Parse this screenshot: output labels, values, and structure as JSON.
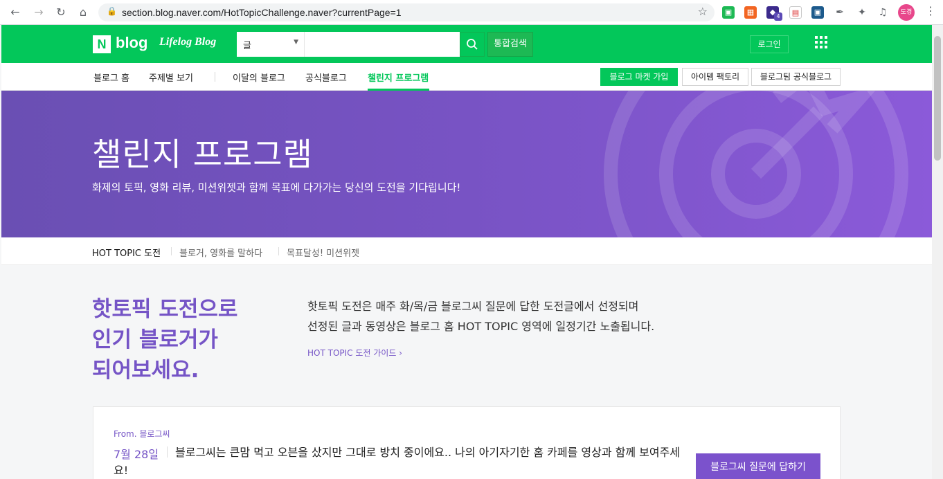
{
  "browser": {
    "url": "section.blog.naver.com/HotTopicChallenge.naver?currentPage=1",
    "profile_label": "도경",
    "ext_badge": "4"
  },
  "gnb": {
    "logo_n": "N",
    "logo_blog": "blog",
    "logo_lifelog": "Lifelog Blog",
    "search_select": "글",
    "search_placeholder": "",
    "total_search": "통합검색",
    "login": "로그인"
  },
  "lnb": {
    "items": [
      "블로그 홈",
      "주제별 보기",
      "이달의 블로그",
      "공식블로그",
      "챌린지 프로그램"
    ],
    "active": "챌린지 프로그램",
    "buttons": [
      "블로그 마켓 가입",
      "아이템 팩토리",
      "블로그팀 공식블로그"
    ]
  },
  "hero": {
    "title": "챌린지 프로그램",
    "subtitle": "화제의 토픽, 영화 리뷰, 미션위젯과 함께 목표에 다가가는 당신의 도전을 기다립니다!"
  },
  "tabs": [
    "HOT TOPIC 도전",
    "블로거, 영화를 말하다",
    "목표달성! 미션위젯"
  ],
  "intro": {
    "headline_lines": [
      "핫토픽 도전으로",
      "인기 블로거가",
      "되어보세요."
    ],
    "description_lines": [
      "핫토픽 도전은 매주 화/목/금 블로그씨 질문에 답한 도전글에서 선정되며",
      "선정된 글과 동영상은 블로그 홈 HOT TOPIC 영역에 일정기간 노출됩니다."
    ],
    "guide_link": "HOT TOPIC 도전 가이드 ›"
  },
  "card": {
    "from": "From. 블로그씨",
    "date": "7월 28일",
    "question": "블로그씨는 큰맘 먹고 오븐을 샀지만 그대로 방치 중이에요.. 나의 아기자기한 홈 카페를 영상과 함께 보여주세요!",
    "answer_button": "블로그씨 질문에 답하기"
  },
  "colors": {
    "naver_green": "#03c75a",
    "purple": "#7554c6",
    "hero_start": "#6a4fb3",
    "hero_end": "#8b5ad9"
  }
}
